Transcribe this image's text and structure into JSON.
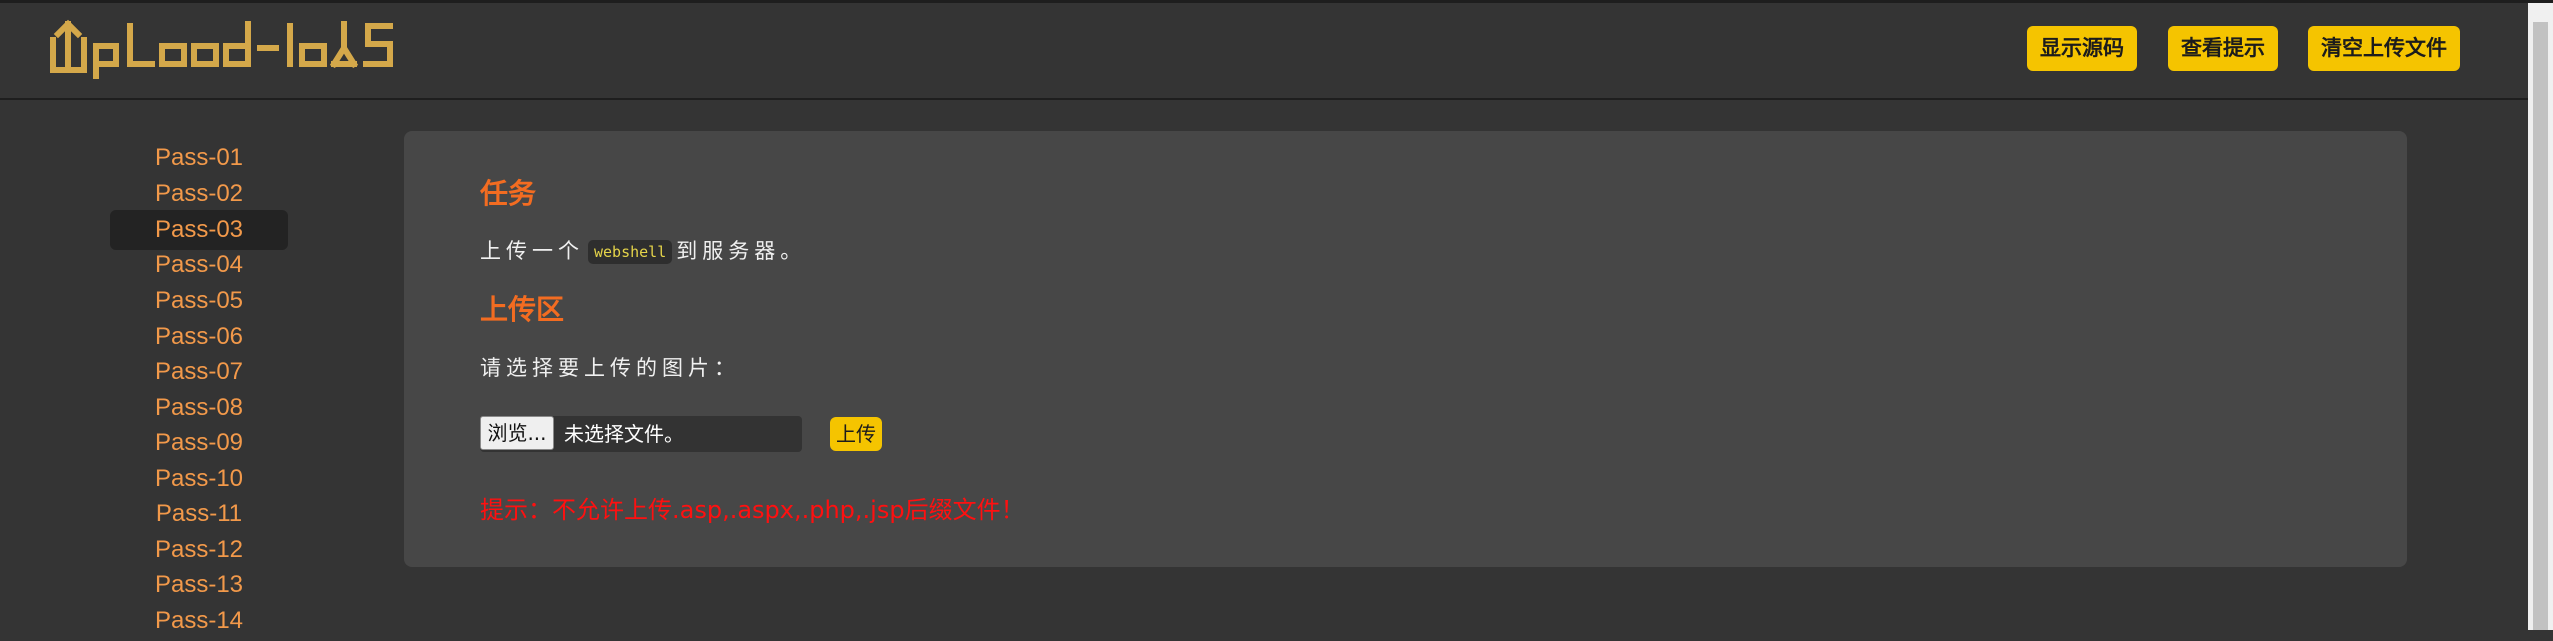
{
  "header": {
    "logo_text": "UpLoad-labS",
    "buttons": [
      "显示源码",
      "查看提示",
      "清空上传文件"
    ]
  },
  "sidebar": {
    "items": [
      "Pass-01",
      "Pass-02",
      "Pass-03",
      "Pass-04",
      "Pass-05",
      "Pass-06",
      "Pass-07",
      "Pass-08",
      "Pass-09",
      "Pass-10",
      "Pass-11",
      "Pass-12",
      "Pass-13",
      "Pass-14"
    ],
    "active": "Pass-03"
  },
  "task": {
    "title": "任务",
    "text_before": "上传一个",
    "code": "webshell",
    "text_after": "到服务器。"
  },
  "upload": {
    "title": "上传区",
    "prompt": "请选择要上传的图片：",
    "browse_label": "浏览...",
    "file_status": "未选择文件。",
    "submit_label": "上传"
  },
  "hint": "提示：不允许上传.asp,.aspx,.php,.jsp后缀文件！",
  "colors": {
    "accent": "#f5c400",
    "title": "#f36c21",
    "sidebar_text": "#f2994a",
    "hint": "#ff1010",
    "background": "#343434",
    "panel": "#474747"
  },
  "icons": {
    "logo": "upload-labs-logo"
  }
}
